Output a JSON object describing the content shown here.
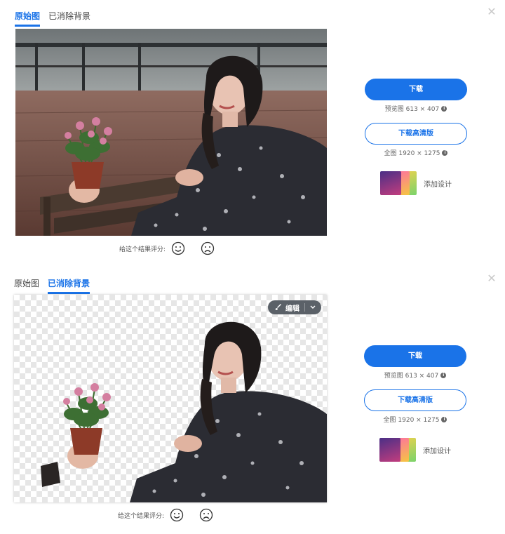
{
  "panels": [
    {
      "tabs": [
        {
          "label": "原始图",
          "active": true
        },
        {
          "label": "已消除背景",
          "active": false
        }
      ],
      "rating": {
        "label": "给这个结果评分:"
      },
      "download": {
        "label": "下载",
        "preview_meta": "预览图 613 × 407"
      },
      "download_hd": {
        "label": "下载高清版",
        "full_meta": "全图 1920 × 1275"
      },
      "add_design": {
        "label": "添加设计"
      }
    },
    {
      "tabs": [
        {
          "label": "原始图",
          "active": false
        },
        {
          "label": "已消除背景",
          "active": true
        }
      ],
      "edit": {
        "label": "编辑"
      },
      "rating": {
        "label": "给这个结果评分:"
      },
      "download": {
        "label": "下载",
        "preview_meta": "预览图 613 × 407"
      },
      "download_hd": {
        "label": "下载高清版",
        "full_meta": "全图 1920 × 1275"
      },
      "add_design": {
        "label": "添加设计"
      }
    }
  ],
  "colors": {
    "accent": "#1a73e8",
    "close": "#c9c9c9",
    "edit_bg": "#5b6168"
  },
  "icons": [
    "close-icon",
    "brush-icon",
    "chevron-down-icon",
    "smile-icon",
    "frown-icon",
    "info-icon"
  ]
}
